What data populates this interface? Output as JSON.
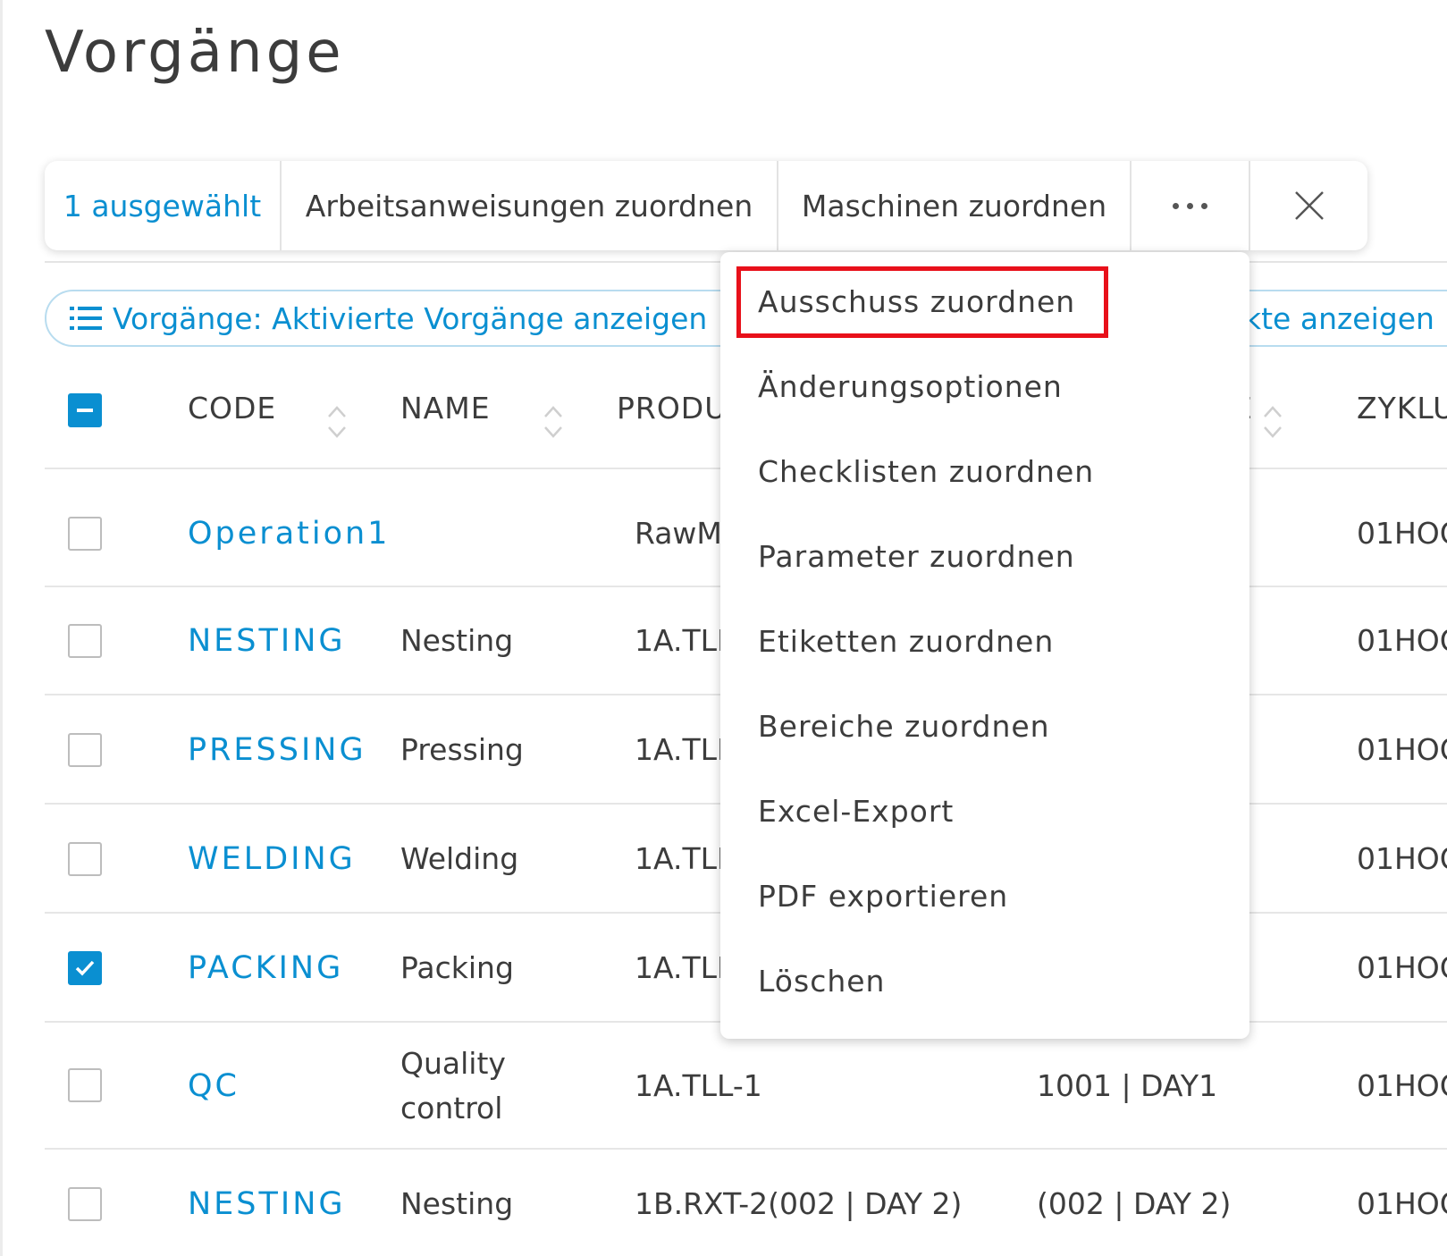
{
  "page": {
    "title": "Vorgänge"
  },
  "toolbar": {
    "selected_label": "1 ausgewählt",
    "assign_instructions": "Arbeitsanweisungen zuordnen",
    "assign_machines": "Maschinen zuordnen",
    "more_icon": "more-horizontal-icon",
    "close_icon": "close-icon"
  },
  "filters": {
    "operations_label": "Vorgänge: Aktivierte Vorgänge anzeigen",
    "right_label": "kte anzeigen"
  },
  "table": {
    "headers": {
      "code": "CODE",
      "name": "NAME",
      "product": "PRODU",
      "hidden_col": "E",
      "cycle": "ZYKLU"
    },
    "rows": [
      {
        "code": "Operation1",
        "name": "",
        "name2": "",
        "product": "RawMa",
        "bom": "",
        "cycle": "01HOO",
        "checked": false
      },
      {
        "code": "NESTING",
        "name": "Nesting",
        "name2": "",
        "product": "1A.TLL",
        "bom": "",
        "cycle": "01HOO",
        "checked": false
      },
      {
        "code": "PRESSING",
        "name": "Pressing",
        "name2": "",
        "product": "1A.TLL",
        "bom": "",
        "cycle": "01HOO",
        "checked": false
      },
      {
        "code": "WELDING",
        "name": "Welding",
        "name2": "",
        "product": "1A.TLL",
        "bom": "",
        "cycle": "01HOO",
        "checked": false
      },
      {
        "code": "PACKING",
        "name": "Packing",
        "name2": "",
        "product": "1A.TLL",
        "bom": "",
        "cycle": "01HOO",
        "checked": true
      },
      {
        "code": "QC",
        "name": "Quality",
        "name2": "control",
        "product": "1A.TLL-1",
        "bom": "1001 | DAY1",
        "cycle": "01HOO",
        "checked": false
      },
      {
        "code": "NESTING",
        "name": "Nesting",
        "name2": "",
        "product": "1B.RXT-2(002 | DAY 2)",
        "bom": "(002 | DAY 2)",
        "cycle": "01HOO",
        "checked": false
      }
    ]
  },
  "menu": {
    "items": [
      "Ausschuss zuordnen",
      "Änderungsoptionen",
      "Checklisten zuordnen",
      "Parameter zuordnen",
      "Etiketten zuordnen",
      "Bereiche zuordnen",
      "Excel-Export",
      "PDF exportieren",
      "Löschen"
    ],
    "highlight_color": "#e8101a"
  },
  "colors": {
    "accent": "#0a8fd1",
    "text": "#3c3c3c"
  }
}
